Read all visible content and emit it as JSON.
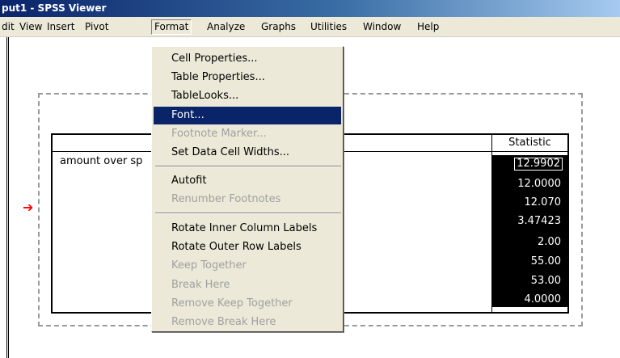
{
  "window": {
    "title": "put1 - SPSS Viewer"
  },
  "menubar": {
    "items": [
      "dit",
      "View",
      "Insert",
      "Pivot",
      "Format",
      "Analyze",
      "Graphs",
      "Utilities",
      "Window",
      "Help"
    ],
    "active": "Format"
  },
  "format_menu": {
    "items": [
      {
        "label": "Cell Properties...",
        "enabled": true
      },
      {
        "label": "Table Properties...",
        "enabled": true
      },
      {
        "label": "TableLooks...",
        "enabled": true
      },
      {
        "label": "Font...",
        "enabled": true,
        "highlighted": true
      },
      {
        "label": "Footnote Marker...",
        "enabled": false
      },
      {
        "label": "Set Data Cell Widths...",
        "enabled": true
      },
      {
        "label": "Autofit",
        "enabled": true
      },
      {
        "label": "Renumber Footnotes",
        "enabled": false
      },
      {
        "label": "Rotate Inner Column Labels",
        "enabled": true
      },
      {
        "label": "Rotate Outer Row Labels",
        "enabled": true
      },
      {
        "label": "Keep Together",
        "enabled": false
      },
      {
        "label": "Break Here",
        "enabled": false
      },
      {
        "label": "Remove Keep Together",
        "enabled": false
      },
      {
        "label": "Remove Break Here",
        "enabled": false
      }
    ]
  },
  "pivot_table": {
    "column_header": "Statistic",
    "row_label": "amount over sp",
    "values": [
      "12.9902",
      "12.0000",
      "12.070",
      "3.47423",
      "2.00",
      "55.00",
      "53.00",
      "4.0000"
    ]
  },
  "colors": {
    "highlight": "#0a246a",
    "arrow": "#ff0000",
    "menu_bg": "#ece9d8"
  },
  "icons": {
    "row_marker": "red-arrow-icon"
  }
}
